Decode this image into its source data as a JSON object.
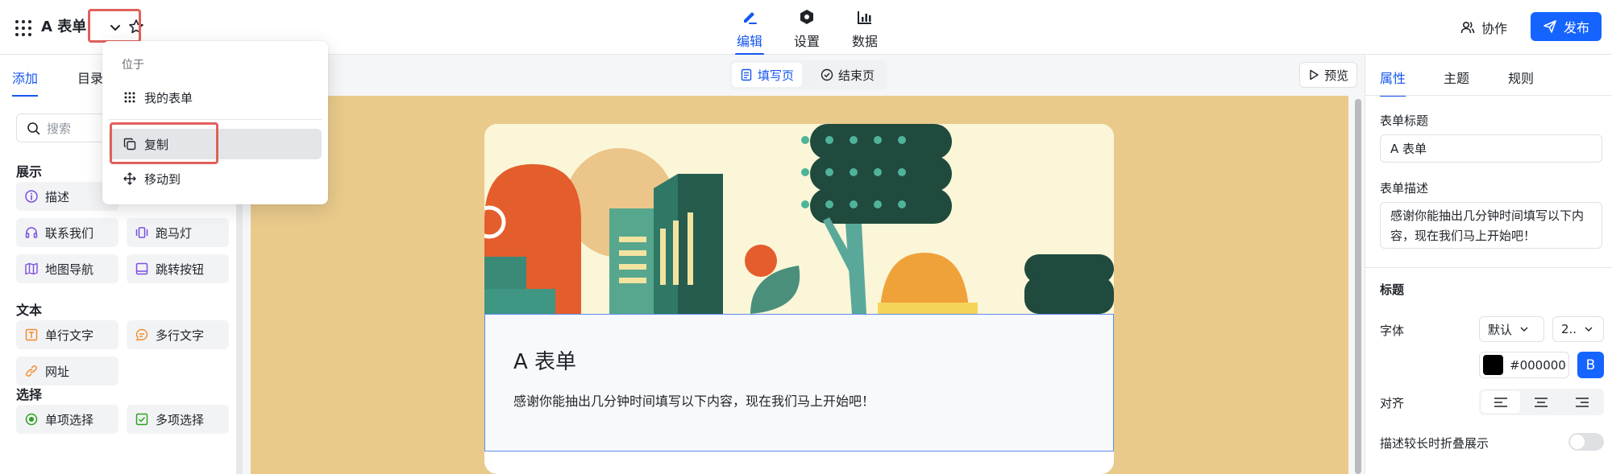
{
  "header": {
    "title": "A 表单",
    "tabs": [
      {
        "label": "编辑",
        "icon": "pen-icon",
        "active": true
      },
      {
        "label": "设置",
        "icon": "hexagon-settings-icon"
      },
      {
        "label": "数据",
        "icon": "bar-chart-icon"
      }
    ],
    "collab_label": "协作",
    "publish_label": "发布"
  },
  "menu": {
    "caption": "位于",
    "location": "我的表单",
    "copy_label": "复制",
    "move_label": "移动到"
  },
  "left": {
    "tabs": [
      "添加",
      "目录"
    ],
    "search_placeholder": "搜索",
    "sections": {
      "display": "展示",
      "text": "文本",
      "select": "选择"
    },
    "items": {
      "describe": "描述",
      "contact": "联系我们",
      "marquee": "跑马灯",
      "map_nav": "地图导航",
      "jump_button": "跳转按钮",
      "single_text": "单行文字",
      "multi_text": "多行文字",
      "url": "网址",
      "single_choice": "单项选择",
      "multi_choice": "多项选择"
    }
  },
  "canvas": {
    "fill_page": "填写页",
    "end_page": "结束页",
    "preview": "预览",
    "form_title": "A 表单",
    "form_desc": "感谢你能抽出几分钟时间填写以下内容，现在我们马上开始吧！",
    "background_color": "#e9ca8b"
  },
  "right": {
    "tabs": [
      "属性",
      "主题",
      "规则"
    ],
    "form_title_label": "表单标题",
    "form_title_value": "A 表单",
    "form_desc_label": "表单描述",
    "form_desc_value": "感谢你能抽出几分钟时间填写以下内容，现在我们马上开始吧！",
    "heading_section": "标题",
    "font_label": "字体",
    "font_value": "默认",
    "size_value": "2..",
    "color_value": "#000000",
    "bold_label": "B",
    "align_label": "对齐",
    "collapse_label": "描述较长时折叠展示"
  },
  "colors": {
    "accent": "#1664ff",
    "highlight": "#e0605b"
  }
}
